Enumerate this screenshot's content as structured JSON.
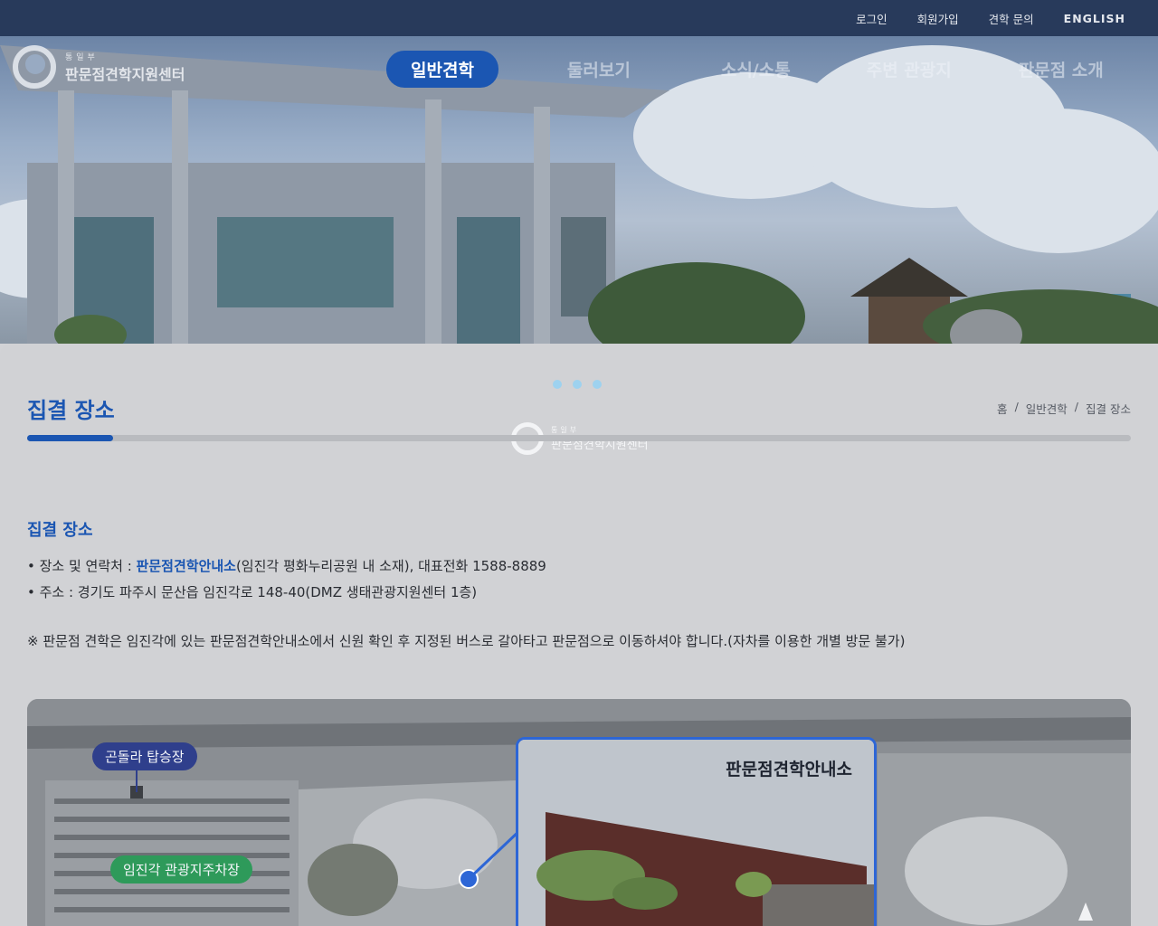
{
  "utility_nav": [
    "로그인",
    "회원가입",
    "견학 문의",
    "ENGLISH"
  ],
  "logo": {
    "small": "통일부",
    "name": "판문점견학지원센터"
  },
  "main_nav": [
    "일반견학",
    "둘러보기",
    "소식/소통",
    "주변 관광지",
    "판문점 소개"
  ],
  "active_nav_index": 0,
  "page": {
    "title": "집결 장소",
    "breadcrumb": [
      "홈",
      "/",
      "일반견학",
      "/",
      "집결 장소"
    ],
    "progress_fraction": 0.078
  },
  "section": {
    "title": "집결 장소",
    "line1_prefix": "• 장소 및 연락처 : ",
    "line1_highlight": "판문점견학안내소",
    "line1_suffix": "(임진각 평화누리공원 내 소재), 대표전화 1588-8889",
    "line2": "• 주소 : 경기도 파주시 문산읍 임진각로 148-40(DMZ 생태관광지원센터 1층)",
    "notice": "※ 판문점 견학은 임진각에 있는 판문점견학안내소에서 신원 확인 후 지정된 버스로 갈아타고 판문점으로 이동하셔야 합니다.(자차를 이용한 개별 방문 불가)"
  },
  "map": {
    "gondola_label": "곤돌라 탑승장",
    "parking_label": "임진각 관광지주차장",
    "photo_label": "판문점견학안내소"
  },
  "colors": {
    "accent": "#1b56b2",
    "topbar": "#283a5b"
  }
}
